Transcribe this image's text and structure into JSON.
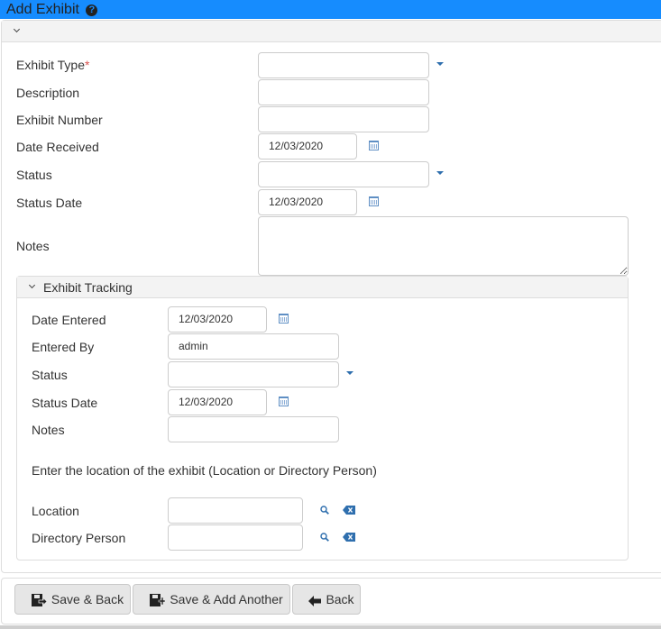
{
  "window": {
    "title": "Add Exhibit",
    "help_icon": "?"
  },
  "form": {
    "fields": {
      "exhibit_type": {
        "label": "Exhibit Type",
        "required_marker": "*",
        "value": ""
      },
      "description": {
        "label": "Description",
        "value": ""
      },
      "exhibit_number": {
        "label": "Exhibit Number",
        "value": ""
      },
      "date_received": {
        "label": "Date Received",
        "value": "12/03/2020"
      },
      "status": {
        "label": "Status",
        "value": ""
      },
      "status_date": {
        "label": "Status Date",
        "value": "12/03/2020"
      },
      "notes": {
        "label": "Notes",
        "value": ""
      }
    }
  },
  "tracking": {
    "title": "Exhibit Tracking",
    "fields": {
      "date_entered": {
        "label": "Date Entered",
        "value": "12/03/2020"
      },
      "entered_by": {
        "label": "Entered By",
        "value": "admin"
      },
      "status": {
        "label": "Status",
        "value": ""
      },
      "status_date": {
        "label": "Status Date",
        "value": "12/03/2020"
      },
      "notes": {
        "label": "Notes",
        "value": ""
      }
    },
    "location_instruction": "Enter the location of the exhibit (Location or Directory Person)",
    "location": {
      "label": "Location",
      "value": ""
    },
    "directory_person": {
      "label": "Directory Person",
      "value": ""
    }
  },
  "footer": {
    "save_back": "Save & Back",
    "save_add_another": "Save & Add Another",
    "back": "Back"
  },
  "colors": {
    "title_bar": "#168cfe",
    "icon_blue": "#2f6fae",
    "required": "#d9534f"
  }
}
